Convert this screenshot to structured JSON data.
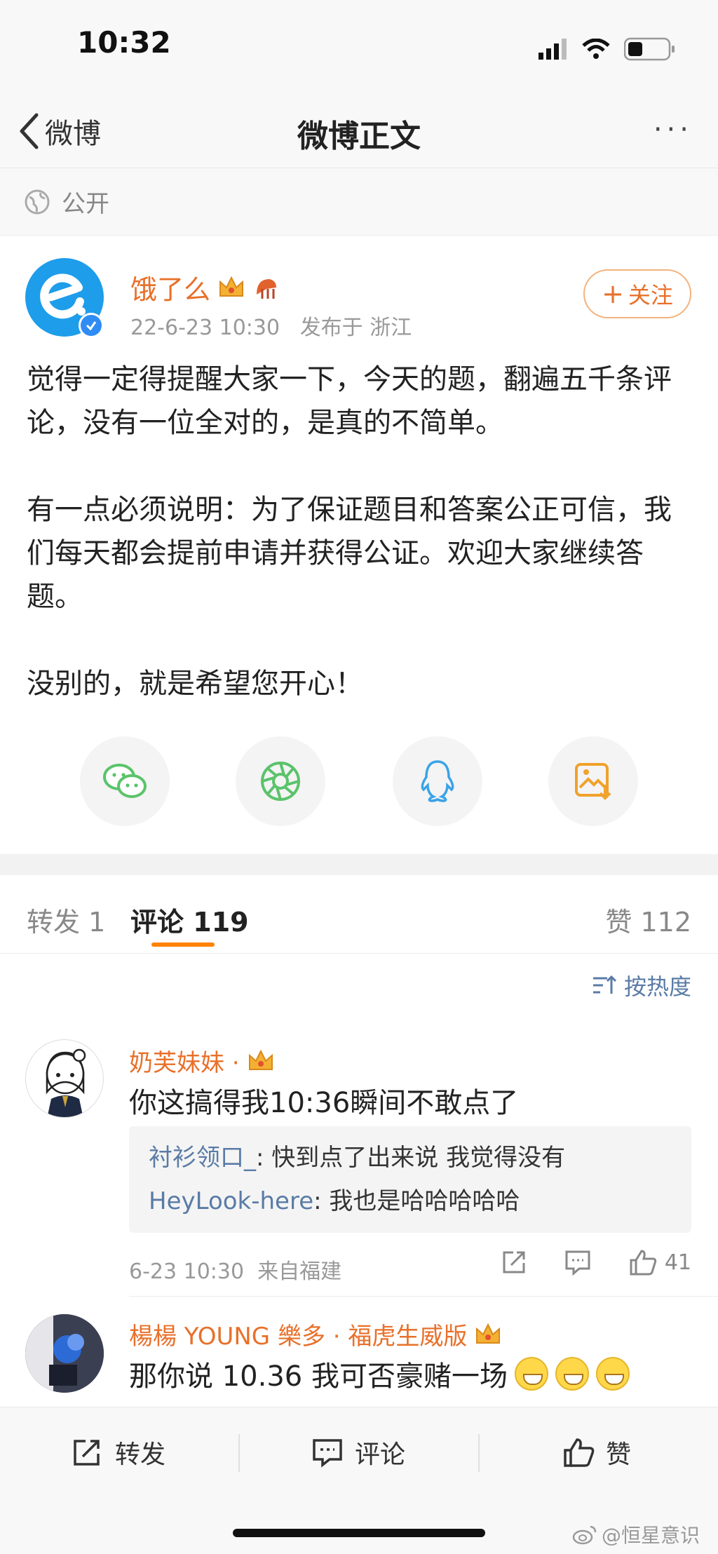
{
  "status_bar": {
    "time": "10:32"
  },
  "nav": {
    "back_label": "微博",
    "title": "微博正文",
    "more": "···"
  },
  "privacy": {
    "label": "公开"
  },
  "post": {
    "author": "饿了么",
    "time": "22-6-23 10:30",
    "location": "发布于 浙江",
    "follow_label": "关注",
    "paragraphs": [
      "觉得一定得提醒大家一下，今天的题，翻遍五千条评论，没有一位全对的，是真的不简单。",
      "有一点必须说明：为了保证题目和答案公正可信，我们每天都会提前申请并获得公证。欢迎大家继续答题。",
      "没别的，就是希望您开心！"
    ]
  },
  "share": {
    "items": [
      {
        "icon": "wechat-icon",
        "color": "#5bc36b"
      },
      {
        "icon": "moments-icon",
        "color": "#5bc36b"
      },
      {
        "icon": "qq-icon",
        "color": "#3aa3e8"
      },
      {
        "icon": "save-image-icon",
        "color": "#f0a22c"
      }
    ]
  },
  "tabs": {
    "repost_label": "转发",
    "repost_count": "1",
    "comment_label": "评论",
    "comment_count": "119",
    "like_label": "赞",
    "like_count": "112"
  },
  "sort": {
    "label": "按热度"
  },
  "comments": [
    {
      "name": "奶芙妹妹 ·",
      "text": "你这搞得我10:36瞬间不敢点了",
      "replies": [
        {
          "user": "衬衫领口_",
          "text": ": 快到点了出来说 我觉得没有"
        },
        {
          "user": "HeyLook-here",
          "text": ": 我也是哈哈哈哈哈"
        }
      ],
      "time": "6-23 10:30",
      "location": "来自福建",
      "likes": "41"
    },
    {
      "name": "楊楊 YOUNG 樂多 · 福虎生威版",
      "text": "那你说 10.36 我可否豪赌一场"
    }
  ],
  "bottom_bar": {
    "repost": "转发",
    "comment": "评论",
    "like": "赞"
  },
  "watermark": "@恒星意识",
  "colors": {
    "accent": "#e8702a",
    "link": "#5a7ba6",
    "tab_indicator": "#ff8200"
  }
}
